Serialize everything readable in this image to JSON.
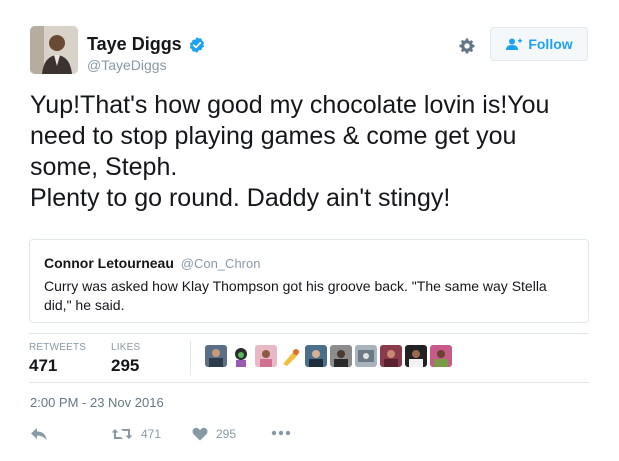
{
  "author": {
    "display_name": "Taye Diggs",
    "handle": "@TayeDiggs",
    "verified": true
  },
  "follow_button": {
    "label": "Follow",
    "icon": "add-user-icon"
  },
  "settings": {
    "icon": "gear-icon"
  },
  "tweet": {
    "lines": [
      "Yup!That's how good my chocolate lovin is!You",
      "need to stop playing games & come get you",
      "some, Steph.",
      "Plenty to go round. Daddy ain't stingy!"
    ]
  },
  "quoted_tweet": {
    "author_name": "Connor Letourneau",
    "author_handle": "@Con_Chron",
    "text": "Curry was asked how Klay Thompson got his groove back. \"The same way Stella did,\" he said."
  },
  "stats": {
    "retweets_label": "RETWEETS",
    "retweets_count": "471",
    "likes_label": "LIKES",
    "likes_count": "295"
  },
  "timestamp": "2:00 PM - 23 Nov 2016",
  "actions": {
    "reply_icon": "reply-icon",
    "retweet_icon": "retweet-icon",
    "retweet_count": "471",
    "like_icon": "heart-icon",
    "like_count": "295",
    "more_icon": "more-dots-icon"
  },
  "colors": {
    "accent": "#1da1f2",
    "muted": "#8899a6",
    "border": "#e1e8ed"
  }
}
